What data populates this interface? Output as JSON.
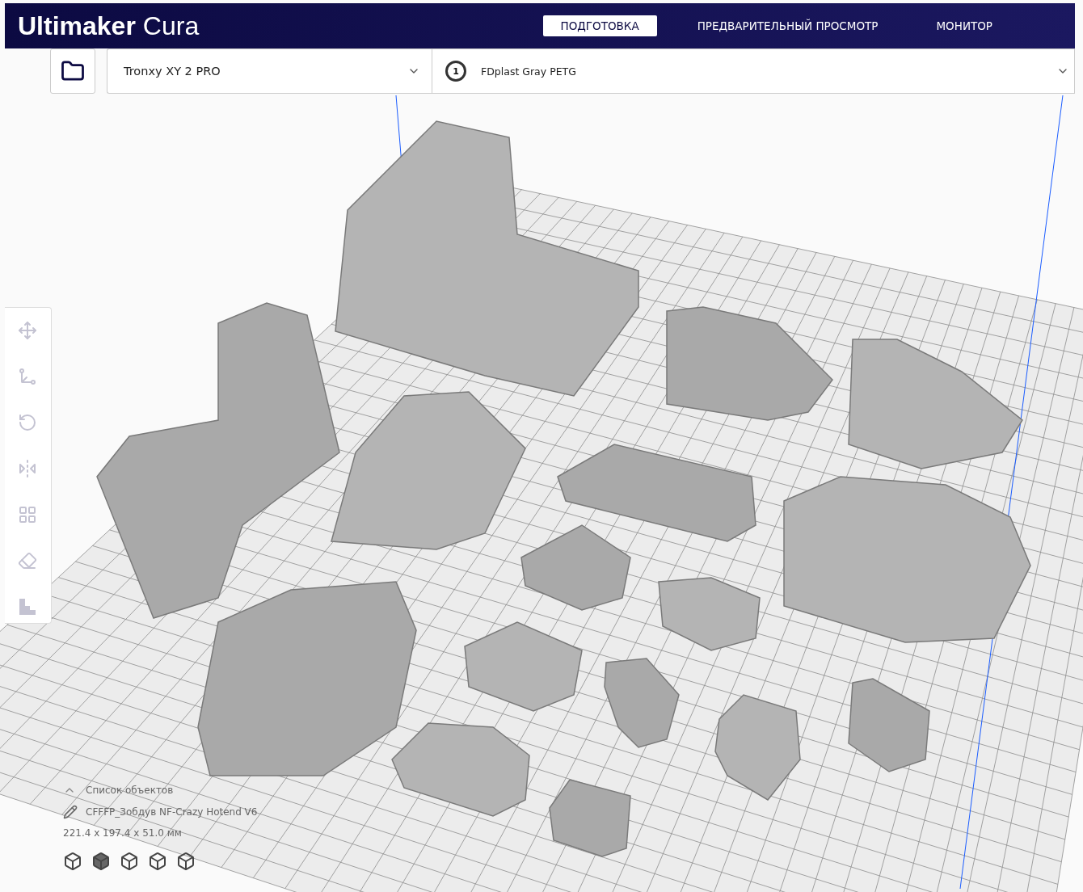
{
  "app_title": {
    "brand": "Ultimaker",
    "product": "Cura"
  },
  "stage_tabs": [
    {
      "label": "ПОДГОТОВКА",
      "selected": true
    },
    {
      "label": "ПРЕДВАРИТЕЛЬНЫЙ ПРОСМОТР",
      "selected": false
    },
    {
      "label": "МОНИТОР",
      "selected": false
    }
  ],
  "printer": {
    "name": "Tronxy XY 2 PRO"
  },
  "material": {
    "extruder": "1",
    "name": "FDplast Gray PETG"
  },
  "object_list": {
    "title": "Список объектов",
    "object_name": "CFFFP_Зобдув NF-Crazy Hotend V6",
    "dimensions": "221.4 x 197.4 x 51.0 мм"
  }
}
